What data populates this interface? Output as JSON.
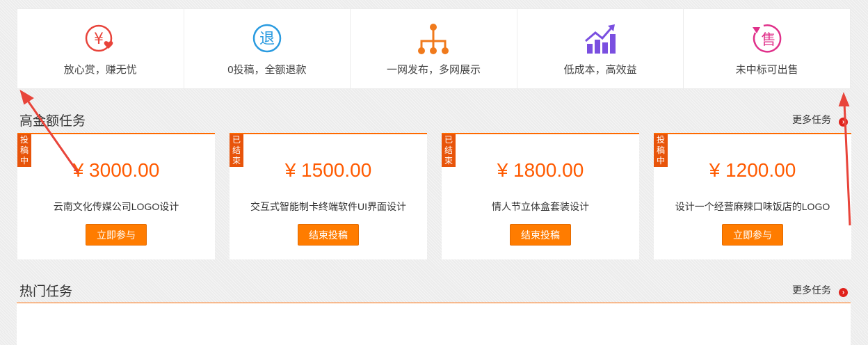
{
  "features": [
    {
      "label": "放心赏，赚无忧",
      "icon": "yen-heart-icon",
      "color": "#e8433a"
    },
    {
      "label": "0投稿，全额退款",
      "icon": "refund-icon",
      "icon_text": "退",
      "color": "#2a9be0"
    },
    {
      "label": "一网发布，多网展示",
      "icon": "network-tree-icon",
      "color": "#f07a1c"
    },
    {
      "label": "低成本，高效益",
      "icon": "growth-chart-icon",
      "color": "#7a4fe0"
    },
    {
      "label": "未中标可出售",
      "icon": "resell-icon",
      "icon_text": "售",
      "color": "#e0308a"
    }
  ],
  "high_tasks": {
    "title": "高金额任务",
    "more": "更多任务",
    "cards": [
      {
        "status": [
          "投",
          "稿",
          "中"
        ],
        "price": "¥ 3000.00",
        "title": "云南文化传媒公司LOGO设计",
        "button": "立即参与"
      },
      {
        "status": [
          "已",
          "结",
          "束"
        ],
        "price": "¥ 1500.00",
        "title": "交互式智能制卡终端软件UI界面设计",
        "button": "结束投稿"
      },
      {
        "status": [
          "已",
          "结",
          "束"
        ],
        "price": "¥ 1800.00",
        "title": "情人节立体盒套装设计",
        "button": "结束投稿"
      },
      {
        "status": [
          "投",
          "稿",
          "中"
        ],
        "price": "¥ 1200.00",
        "title": "设计一个经营麻辣口味饭店的LOGO",
        "button": "立即参与"
      }
    ]
  },
  "hot_tasks": {
    "title": "热门任务",
    "more": "更多任务"
  },
  "colors": {
    "accent": "#ff6a00",
    "price": "#ff5a00",
    "button": "#ff7c00",
    "badge": "#e8540a",
    "annotation_arrow": "#e8443a"
  }
}
